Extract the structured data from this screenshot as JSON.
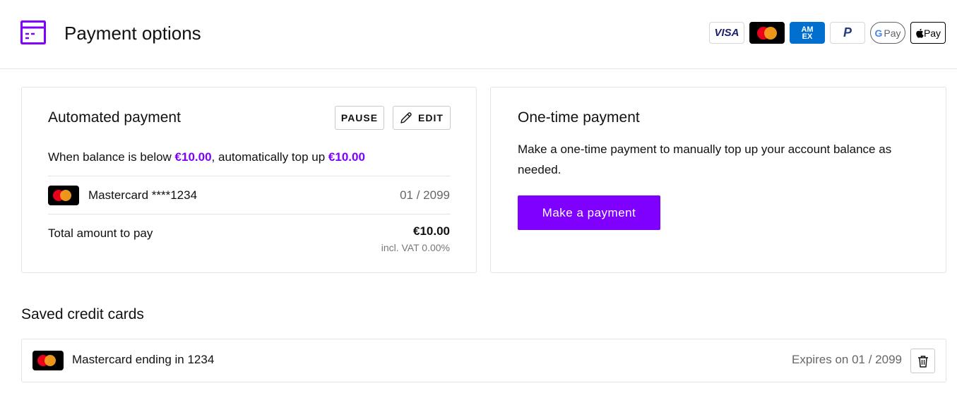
{
  "header": {
    "title": "Payment options",
    "icon": "credit-card-icon",
    "accent_color": "#7f00ff",
    "brands": {
      "visa": "VISA",
      "amex_line1": "AM",
      "amex_line2": "EX",
      "paypal": "P",
      "gpay_g": "G",
      "gpay": "Pay",
      "apay": "Pay"
    }
  },
  "automated": {
    "title": "Automated payment",
    "pause_label": "PAUSE",
    "edit_label": "EDIT",
    "rule_prefix": "When balance is below ",
    "threshold": "€10.00",
    "rule_middle": ", automatically top up ",
    "topup": "€10.00",
    "card_name": "Mastercard ****1234",
    "card_expiry": "01 / 2099",
    "total_label": "Total amount to pay",
    "total_amount": "€10.00",
    "vat_note": "incl. VAT 0.00%"
  },
  "onetime": {
    "title": "One-time payment",
    "description": "Make a one-time payment to manually top up your account balance as needed.",
    "button_label": "Make a payment"
  },
  "saved": {
    "title": "Saved credit cards",
    "cards": [
      {
        "name": "Mastercard ending in 1234",
        "expiry": "Expires on 01 / 2099"
      }
    ]
  }
}
